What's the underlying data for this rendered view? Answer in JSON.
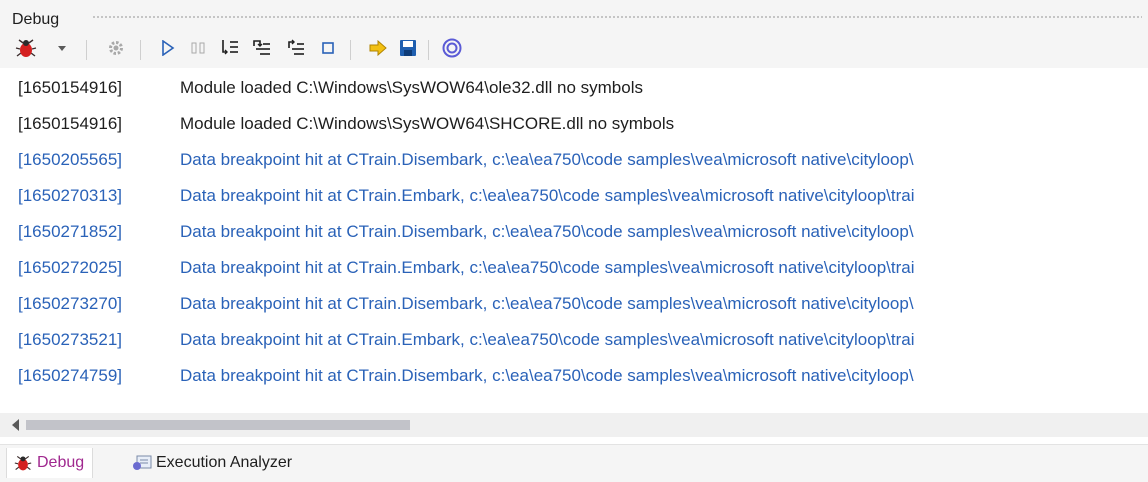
{
  "panel": {
    "title": "Debug"
  },
  "toolbar": {
    "buttons": [
      {
        "icon": "debugger-bug-icon"
      },
      {
        "icon": "dropdown-arrow-icon"
      },
      {
        "icon": "settings-gear-icon"
      },
      {
        "icon": "run-icon"
      },
      {
        "icon": "pause-icon"
      },
      {
        "icon": "step-in-icon"
      },
      {
        "icon": "step-over-icon"
      },
      {
        "icon": "step-out-icon"
      },
      {
        "icon": "stop-icon"
      },
      {
        "icon": "jump-arrow-icon"
      },
      {
        "icon": "save-icon"
      },
      {
        "icon": "help-icon"
      }
    ]
  },
  "log": {
    "entries": [
      {
        "id": "[1650154916]",
        "message": "Module loaded C:\\Windows\\SysWOW64\\ole32.dll no symbols",
        "kind": "info"
      },
      {
        "id": "[1650154916]",
        "message": "Module loaded C:\\Windows\\SysWOW64\\SHCORE.dll no symbols",
        "kind": "info"
      },
      {
        "id": "[1650205565]",
        "message": "Data breakpoint hit at CTrain.Disembark, c:\\ea\\ea750\\code samples\\vea\\microsoft native\\cityloop\\",
        "kind": "breakpoint"
      },
      {
        "id": "[1650270313]",
        "message": "Data breakpoint hit at CTrain.Embark, c:\\ea\\ea750\\code samples\\vea\\microsoft native\\cityloop\\trai",
        "kind": "breakpoint"
      },
      {
        "id": "[1650271852]",
        "message": "Data breakpoint hit at CTrain.Disembark, c:\\ea\\ea750\\code samples\\vea\\microsoft native\\cityloop\\",
        "kind": "breakpoint"
      },
      {
        "id": "[1650272025]",
        "message": "Data breakpoint hit at CTrain.Embark, c:\\ea\\ea750\\code samples\\vea\\microsoft native\\cityloop\\trai",
        "kind": "breakpoint"
      },
      {
        "id": "[1650273270]",
        "message": "Data breakpoint hit at CTrain.Disembark, c:\\ea\\ea750\\code samples\\vea\\microsoft native\\cityloop\\",
        "kind": "breakpoint"
      },
      {
        "id": "[1650273521]",
        "message": "Data breakpoint hit at CTrain.Embark, c:\\ea\\ea750\\code samples\\vea\\microsoft native\\cityloop\\trai",
        "kind": "breakpoint"
      },
      {
        "id": "[1650274759]",
        "message": "Data breakpoint hit at CTrain.Disembark, c:\\ea\\ea750\\code samples\\vea\\microsoft native\\cityloop\\",
        "kind": "breakpoint"
      }
    ]
  },
  "colors": {
    "breakpoint_text": "#2a62b8",
    "info_text": "#1e1e1e",
    "active_tab_text": "#a0288f"
  },
  "tabs": [
    {
      "label": "Debug",
      "icon": "debugger-bug-icon",
      "active": true
    },
    {
      "label": "Execution Analyzer",
      "icon": "execution-analyzer-icon",
      "active": false
    }
  ]
}
